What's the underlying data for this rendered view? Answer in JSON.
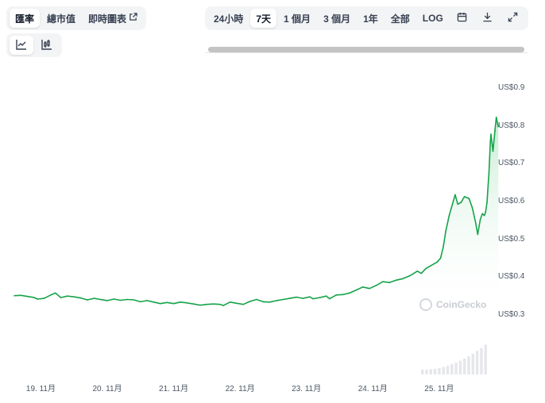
{
  "tabs": [
    {
      "label": "匯率",
      "active": true
    },
    {
      "label": "總市值",
      "active": false
    },
    {
      "label": "即時圖表",
      "active": false,
      "external": true
    }
  ],
  "chart_types": [
    {
      "icon": "line-chart-icon",
      "active": true
    },
    {
      "icon": "candlestick-chart-icon",
      "active": false
    }
  ],
  "ranges": [
    {
      "label": "24小時",
      "active": false
    },
    {
      "label": "7天",
      "active": true
    },
    {
      "label": "1 個月",
      "active": false
    },
    {
      "label": "3 個月",
      "active": false
    },
    {
      "label": "1年",
      "active": false
    },
    {
      "label": "全部",
      "active": false
    },
    {
      "label": "LOG",
      "active": false
    }
  ],
  "toolbar_icons": [
    "calendar-icon",
    "download-icon",
    "fullscreen-icon"
  ],
  "watermark": "CoinGecko",
  "colors": {
    "line": "#16a34a",
    "area_top": "#b7e7c8",
    "volume": "#e5e7eb"
  },
  "chart_data": {
    "type": "line",
    "title": "",
    "xlabel": "",
    "ylabel": "",
    "x_ticks": [
      "19. 11月",
      "20. 11月",
      "21. 11月",
      "22. 11月",
      "23. 11月",
      "24. 11月",
      "25. 11月"
    ],
    "y_ticks": [
      "US$0.3",
      "US$0.4",
      "US$0.5",
      "US$0.6",
      "US$0.7",
      "US$0.8",
      "US$0.9"
    ],
    "y_tick_values": [
      0.3,
      0.4,
      0.5,
      0.6,
      0.7,
      0.8,
      0.9
    ],
    "ylim": [
      0.3,
      0.9
    ],
    "xlim": [
      18.6,
      25.72
    ],
    "grid": false,
    "series": [
      {
        "values": [
          [
            18.6,
            0.353
          ],
          [
            18.7,
            0.354
          ],
          [
            18.8,
            0.351
          ],
          [
            18.9,
            0.348
          ],
          [
            18.95,
            0.344
          ],
          [
            19.05,
            0.346
          ],
          [
            19.15,
            0.355
          ],
          [
            19.22,
            0.36
          ],
          [
            19.3,
            0.348
          ],
          [
            19.4,
            0.352
          ],
          [
            19.5,
            0.35
          ],
          [
            19.6,
            0.347
          ],
          [
            19.7,
            0.342
          ],
          [
            19.8,
            0.346
          ],
          [
            19.9,
            0.343
          ],
          [
            20.0,
            0.34
          ],
          [
            20.1,
            0.344
          ],
          [
            20.2,
            0.341
          ],
          [
            20.3,
            0.343
          ],
          [
            20.4,
            0.342
          ],
          [
            20.5,
            0.337
          ],
          [
            20.6,
            0.34
          ],
          [
            20.7,
            0.336
          ],
          [
            20.8,
            0.332
          ],
          [
            20.9,
            0.335
          ],
          [
            21.0,
            0.332
          ],
          [
            21.1,
            0.336
          ],
          [
            21.2,
            0.334
          ],
          [
            21.3,
            0.331
          ],
          [
            21.4,
            0.328
          ],
          [
            21.5,
            0.33
          ],
          [
            21.6,
            0.331
          ],
          [
            21.7,
            0.33
          ],
          [
            21.75,
            0.327
          ],
          [
            21.85,
            0.336
          ],
          [
            21.95,
            0.333
          ],
          [
            22.05,
            0.33
          ],
          [
            22.15,
            0.338
          ],
          [
            22.25,
            0.343
          ],
          [
            22.35,
            0.337
          ],
          [
            22.45,
            0.336
          ],
          [
            22.55,
            0.34
          ],
          [
            22.65,
            0.343
          ],
          [
            22.75,
            0.346
          ],
          [
            22.85,
            0.349
          ],
          [
            22.95,
            0.346
          ],
          [
            23.05,
            0.35
          ],
          [
            23.1,
            0.345
          ],
          [
            23.2,
            0.348
          ],
          [
            23.3,
            0.352
          ],
          [
            23.35,
            0.345
          ],
          [
            23.45,
            0.355
          ],
          [
            23.55,
            0.356
          ],
          [
            23.65,
            0.36
          ],
          [
            23.75,
            0.368
          ],
          [
            23.85,
            0.376
          ],
          [
            23.95,
            0.372
          ],
          [
            24.05,
            0.38
          ],
          [
            24.15,
            0.39
          ],
          [
            24.25,
            0.388
          ],
          [
            24.35,
            0.394
          ],
          [
            24.45,
            0.398
          ],
          [
            24.55,
            0.405
          ],
          [
            24.6,
            0.41
          ],
          [
            24.67,
            0.418
          ],
          [
            24.73,
            0.412
          ],
          [
            24.8,
            0.425
          ],
          [
            24.87,
            0.432
          ],
          [
            24.93,
            0.438
          ],
          [
            24.97,
            0.442
          ],
          [
            25.02,
            0.452
          ],
          [
            25.06,
            0.48
          ],
          [
            25.1,
            0.525
          ],
          [
            25.15,
            0.565
          ],
          [
            25.2,
            0.595
          ],
          [
            25.24,
            0.62
          ],
          [
            25.28,
            0.595
          ],
          [
            25.33,
            0.6
          ],
          [
            25.38,
            0.615
          ],
          [
            25.45,
            0.61
          ],
          [
            25.5,
            0.585
          ],
          [
            25.55,
            0.545
          ],
          [
            25.58,
            0.515
          ],
          [
            25.62,
            0.555
          ],
          [
            25.65,
            0.57
          ],
          [
            25.68,
            0.565
          ],
          [
            25.7,
            0.575
          ],
          [
            25.72,
            0.6
          ],
          [
            25.75,
            0.68
          ],
          [
            25.77,
            0.76
          ],
          [
            25.78,
            0.78
          ],
          [
            25.81,
            0.735
          ],
          [
            25.84,
            0.79
          ],
          [
            25.86,
            0.825
          ],
          [
            25.89,
            0.8
          ]
        ]
      }
    ]
  }
}
